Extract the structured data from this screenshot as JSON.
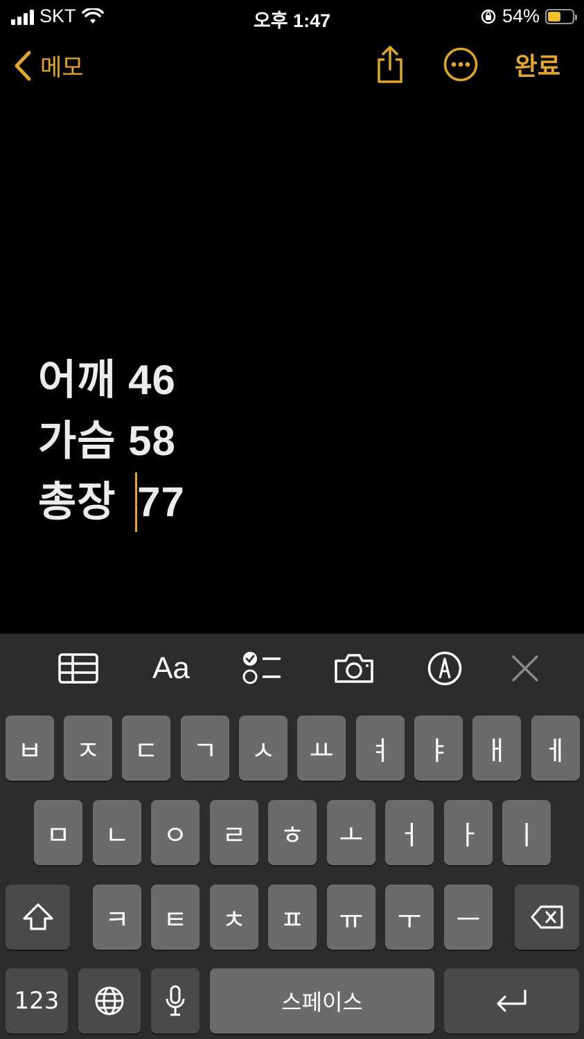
{
  "status_bar": {
    "carrier": "SKT",
    "time": "오후 1:47",
    "battery_percent": "54%",
    "battery_level": 0.54
  },
  "nav": {
    "back_label": "메모",
    "done_label": "완료",
    "accent_color": "#e2a52f"
  },
  "note": {
    "lines": [
      "어깨 46",
      "가슴 58",
      "총장 "
    ],
    "last_line_after_cursor": "77"
  },
  "toolbar": {
    "items": [
      "table-icon",
      "format-icon",
      "checklist-icon",
      "camera-icon",
      "markup-icon",
      "close-icon"
    ],
    "format_label": "Aa"
  },
  "keyboard": {
    "row1": [
      "ㅂ",
      "ㅈ",
      "ㄷ",
      "ㄱ",
      "ㅅ",
      "ㅛ",
      "ㅕ",
      "ㅑ",
      "ㅐ",
      "ㅔ"
    ],
    "row2": [
      "ㅁ",
      "ㄴ",
      "ㅇ",
      "ㄹ",
      "ㅎ",
      "ㅗ",
      "ㅓ",
      "ㅏ",
      "ㅣ"
    ],
    "row3": [
      "ㅋ",
      "ㅌ",
      "ㅊ",
      "ㅍ",
      "ㅠ",
      "ㅜ",
      "ㅡ"
    ],
    "numbers_label": "123",
    "space_label": "스페이스"
  }
}
